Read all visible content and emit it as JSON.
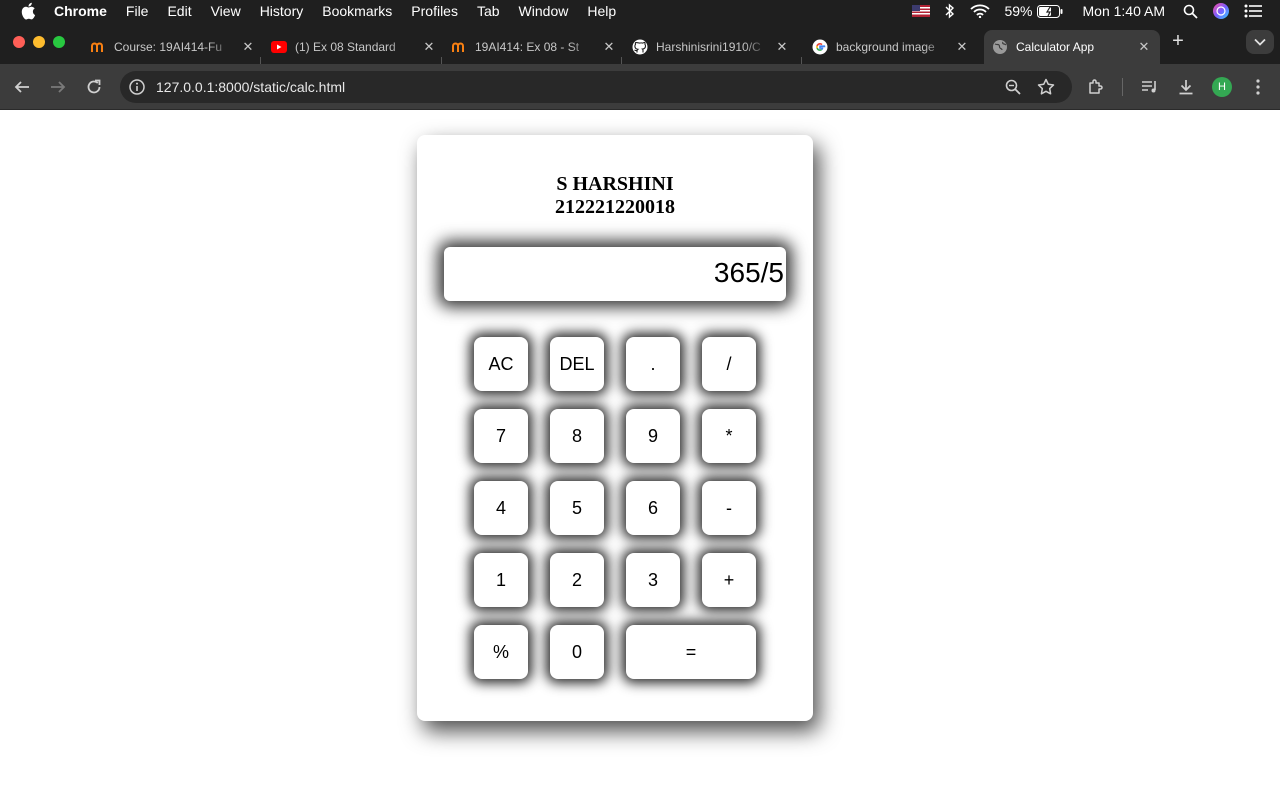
{
  "menubar": {
    "app_name": "Chrome",
    "menus": [
      "File",
      "Edit",
      "View",
      "History",
      "Bookmarks",
      "Profiles",
      "Tab",
      "Window",
      "Help"
    ],
    "battery": "59%",
    "clock": "Mon 1:40 AM"
  },
  "tabs": [
    {
      "title": "Course: 19AI414-Fu",
      "icon": "moodle-icon"
    },
    {
      "title": "(1) Ex 08 Standard",
      "icon": "youtube-icon"
    },
    {
      "title": "19AI414: Ex 08 - St",
      "icon": "moodle-icon"
    },
    {
      "title": "Harshinisrini1910/C",
      "icon": "github-icon"
    },
    {
      "title": "background image",
      "icon": "google-icon"
    },
    {
      "title": "Calculator App",
      "icon": "globe-icon"
    }
  ],
  "address_bar": {
    "url": "127.0.0.1:8000/static/calc.html"
  },
  "profile_initial": "H",
  "calculator": {
    "student_name": "S HARSHINI",
    "student_id": "212221220018",
    "display_value": "365/5",
    "keys": {
      "ac": "AC",
      "del": "DEL",
      "dot": ".",
      "divide": "/",
      "seven": "7",
      "eight": "8",
      "nine": "9",
      "multiply": "*",
      "four": "4",
      "five": "5",
      "six": "6",
      "minus": "-",
      "one": "1",
      "two": "2",
      "three": "3",
      "plus": "+",
      "percent": "%",
      "zero": "0",
      "equals": "="
    }
  },
  "colors": {
    "chrome_dark": "#1f1f1f",
    "toolbar": "#3c3c3c",
    "omnibox": "#282828",
    "profile_green": "#34a853"
  }
}
